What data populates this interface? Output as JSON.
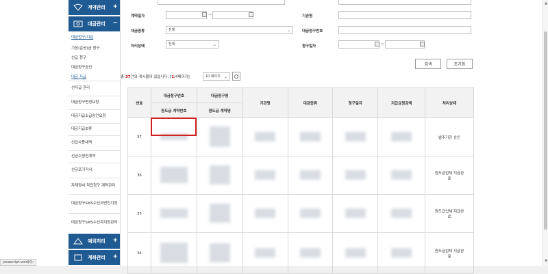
{
  "sidebar": {
    "section_contract": "계약관리",
    "section_payment": "대금관리",
    "payment_items": [
      "대금청구/지급",
      "기성(준공)금 청구",
      "선급 청구",
      "대금청구승인",
      "대금 지급"
    ],
    "groups": [
      "선지급 관리",
      "대금청구변경요청",
      "대금지급소급승인요청",
      "대금지급보류",
      "선급사용내역",
      "선금수령현계약",
      "선금포기각서",
      "자재장비 직접청구 계약관리",
      "대금청구SMS수신자변인지정",
      "대금청구SMS수신자지정관리"
    ],
    "section_notice": "예외처리",
    "section_account": "계좌관리"
  },
  "form": {
    "contract_date_label": "계약일자",
    "date_sep": "~",
    "org_label": "기관명",
    "payment_type_label": "대금종류",
    "payment_type_value": "전체",
    "request_no_label": "대금청구번호",
    "status_label": "처리상태",
    "status_value": "전체",
    "request_date_label": "청구일자"
  },
  "buttons": {
    "search": "검색",
    "reset": "초기화"
  },
  "result": {
    "prefix": "총",
    "count": "37",
    "middle": "건의 게시물이 있습니다. [",
    "page": "1",
    "suffix": "/4페이지]",
    "per_page": "10 페이지"
  },
  "table": {
    "headers": {
      "no": "번호",
      "req_no": "대금청구번호",
      "sub_no": "원도급 계약번호",
      "req_name": "대금청구명",
      "sub_name": "원도급 계약명",
      "org": "기관명",
      "type": "대금종류",
      "date": "청구일자",
      "amount": "지급요청금액",
      "status": "처리상태"
    },
    "rows": [
      {
        "no": "37",
        "status": "발주기관 승인"
      },
      {
        "no": "36",
        "status": "원도급업체 지급완료"
      },
      {
        "no": "35",
        "status": "원도급업체 지급완료"
      },
      {
        "no": "34",
        "status": "원도급업체 지급완료"
      }
    ]
  },
  "status_bar": "javascript:void(0);"
}
